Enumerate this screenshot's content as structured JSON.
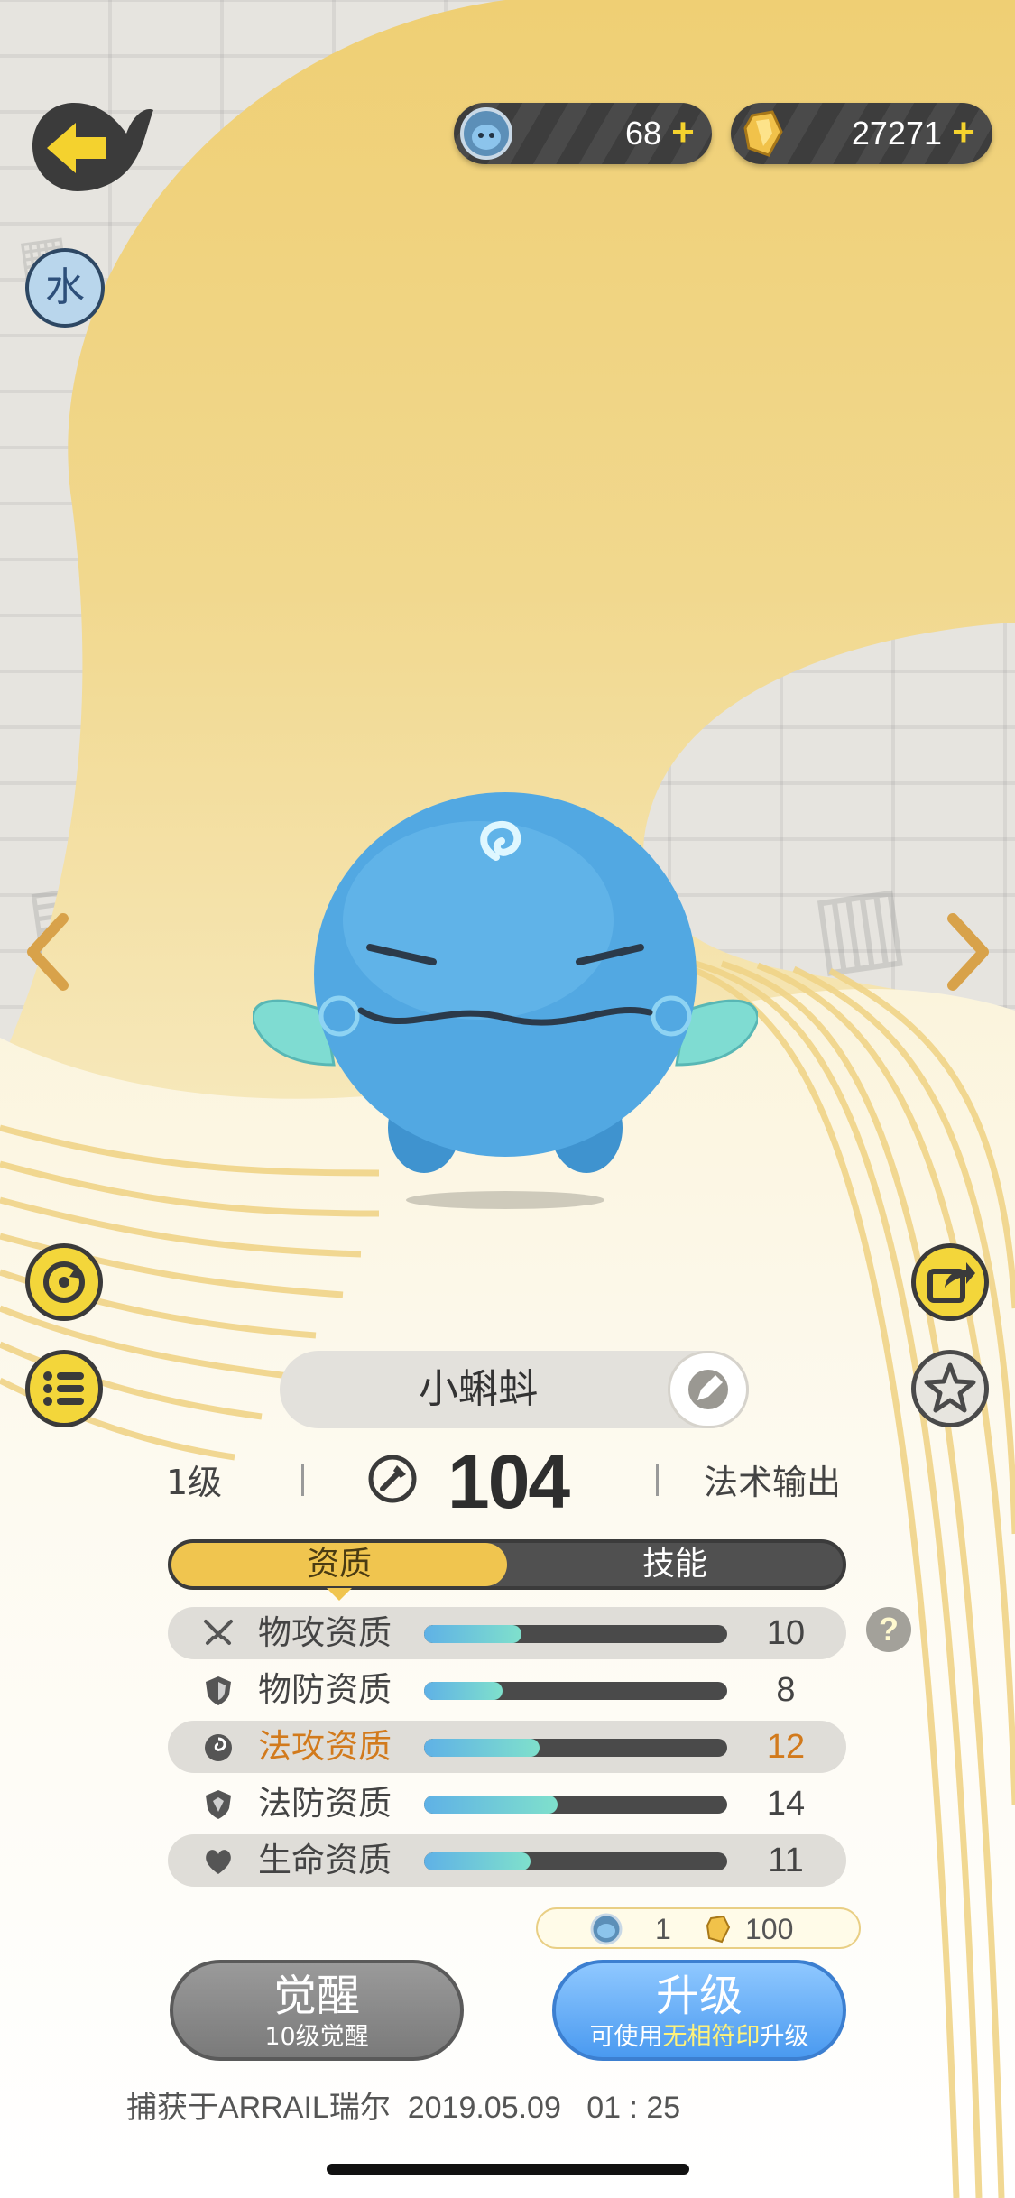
{
  "currencies": [
    {
      "icon": "spirit-orb-icon",
      "value": "68",
      "plus": "+"
    },
    {
      "icon": "gold-crystal-icon",
      "value": "27271",
      "plus": "+"
    }
  ],
  "element_badge": "水",
  "pet": {
    "name": "小蝌蚪",
    "level": "1级",
    "power": "104",
    "role": "法术输出"
  },
  "tabs": [
    {
      "label": "资质",
      "active": true
    },
    {
      "label": "技能",
      "active": false
    }
  ],
  "attributes": [
    {
      "icon": "crossed-swords-icon",
      "label": "物攻资质",
      "value": "10",
      "fill": 0.32,
      "highlight": false
    },
    {
      "icon": "shield-icon",
      "label": "物防资质",
      "value": "8",
      "fill": 0.26,
      "highlight": false
    },
    {
      "icon": "swirl-icon",
      "label": "法攻资质",
      "value": "12",
      "fill": 0.38,
      "highlight": true
    },
    {
      "icon": "magic-shield-icon",
      "label": "法防资质",
      "value": "14",
      "fill": 0.44,
      "highlight": false
    },
    {
      "icon": "heart-icon",
      "label": "生命资质",
      "value": "11",
      "fill": 0.35,
      "highlight": false
    }
  ],
  "help_label": "?",
  "upgrade_cost": {
    "orb": "1",
    "gold": "100"
  },
  "buttons": {
    "awaken": {
      "title": "觉醒",
      "subtitle": "10级觉醒"
    },
    "upgrade": {
      "title": "升级",
      "sub_prefix": "可使用",
      "sub_highlight": "无相符印",
      "sub_suffix": "升级"
    }
  },
  "capture_info": "捕获于ARRAIL瑞尔  2019.05.09   01 : 25",
  "colors": {
    "accent_yellow": "#f0c54f",
    "button_blue": "#4a9af0",
    "highlight_orange": "#d27a1c",
    "bar_gradient_start": "#5fb1e6",
    "bar_gradient_end": "#7fe0cc"
  }
}
